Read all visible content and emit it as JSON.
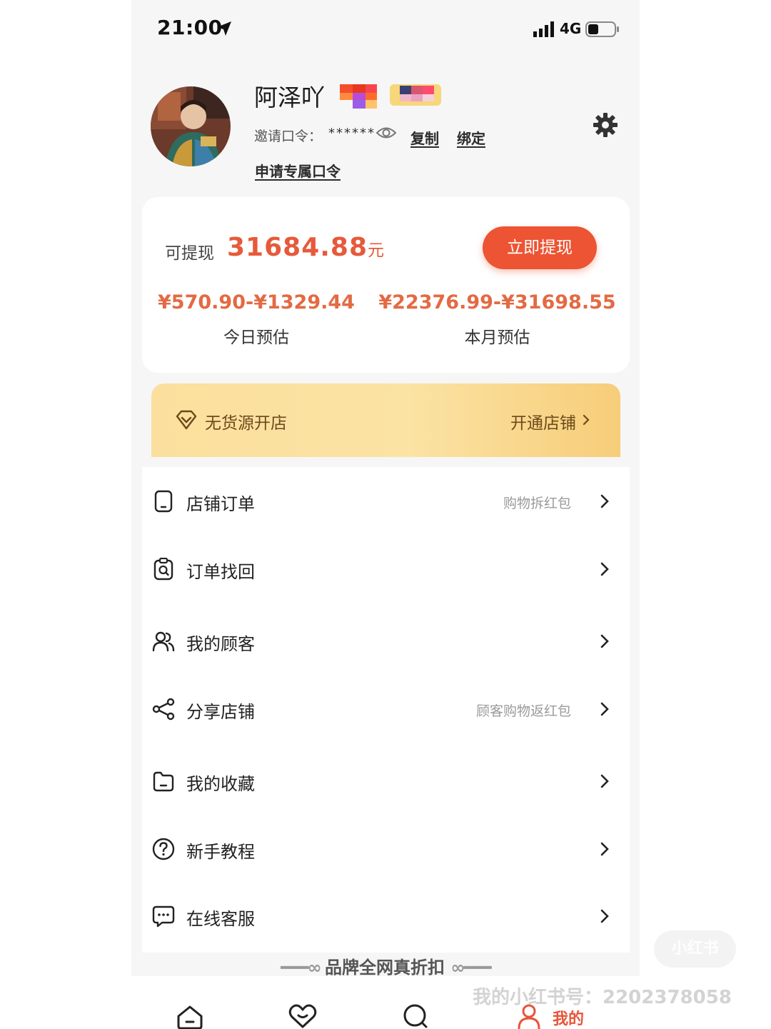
{
  "status_bar": {
    "time": "21:00",
    "network": "4G"
  },
  "profile": {
    "name": "阿泽吖",
    "invite_label": "邀请口令：",
    "invite_code": "******",
    "copy_label": "复制",
    "bind_label": "绑定",
    "apply_label": "申请专属口令"
  },
  "wallet": {
    "withdraw_label": "可提现",
    "withdraw_amount": "31684.88",
    "withdraw_unit": "元",
    "withdraw_button": "立即提现",
    "today_range": "¥570.90-¥1329.44",
    "today_label": "今日预估",
    "month_range": "¥22376.99-¥31698.55",
    "month_label": "本月预估"
  },
  "store_banner": {
    "text": "无货源开店",
    "action": "开通店铺"
  },
  "menu": [
    {
      "label": "店铺订单",
      "hint": "购物拆红包",
      "icon": "phone-icon"
    },
    {
      "label": "订单找回",
      "hint": "",
      "icon": "order-search-icon"
    },
    {
      "label": "我的顾客",
      "hint": "",
      "icon": "customers-icon"
    },
    {
      "label": "分享店铺",
      "hint": "顾客购物返红包",
      "icon": "share-icon"
    },
    {
      "label": "我的收藏",
      "hint": "",
      "icon": "folder-icon"
    },
    {
      "label": "新手教程",
      "hint": "",
      "icon": "help-icon"
    },
    {
      "label": "在线客服",
      "hint": "",
      "icon": "chat-icon"
    }
  ],
  "brand_strip": "品牌全网真折扣",
  "tab_bar": {
    "mine_label": "我的"
  },
  "watermark": {
    "text": "我的小红书号：2202378058",
    "logo": "小红书"
  },
  "colors": {
    "accent": "#ec5433",
    "amount": "#e65a3b",
    "banner": "#fbdf9d"
  }
}
